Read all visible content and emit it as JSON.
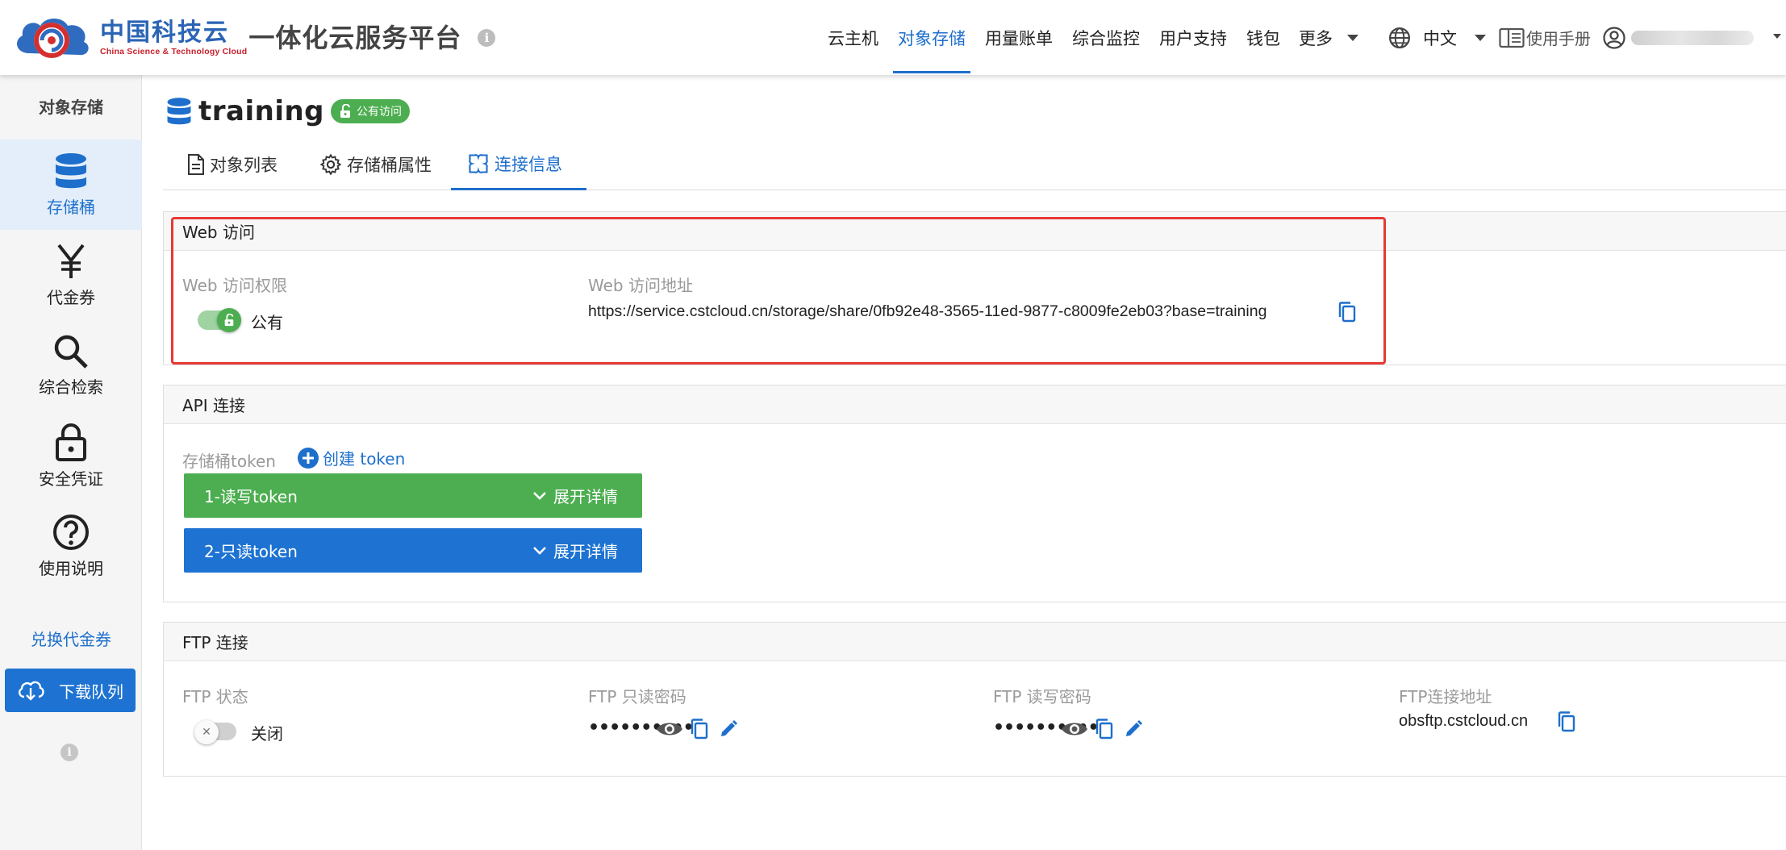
{
  "header": {
    "logo_cn": "中国科技云",
    "logo_en": "China Science & Technology Cloud",
    "platform_title": "一体化云服务平台",
    "nav": [
      {
        "label": "云主机"
      },
      {
        "label": "对象存储"
      },
      {
        "label": "用量账单"
      },
      {
        "label": "综合监控"
      },
      {
        "label": "用户支持"
      },
      {
        "label": "钱包"
      },
      {
        "label": "更多"
      }
    ],
    "language": "中文",
    "manual": "使用手册",
    "accent_color": "#1e6fcc"
  },
  "sidebar": {
    "title": "对象存储",
    "items": [
      {
        "label": "存储桶",
        "icon": "database-icon"
      },
      {
        "label": "代金券",
        "icon": "yen-icon"
      },
      {
        "label": "综合检索",
        "icon": "search-icon"
      },
      {
        "label": "安全凭证",
        "icon": "lock-icon"
      },
      {
        "label": "使用说明",
        "icon": "question-icon"
      }
    ],
    "redeem_link": "兑换代金券",
    "download_queue": "下载队列"
  },
  "bucket": {
    "name": "training",
    "badge": "公有访问"
  },
  "tabs": [
    {
      "label": "对象列表"
    },
    {
      "label": "存储桶属性"
    },
    {
      "label": "连接信息"
    }
  ],
  "web_access": {
    "title": "Web 访问",
    "permission_label": "Web 访问权限",
    "permission_value": "公有",
    "address_label": "Web 访问地址",
    "address_value": "https://service.cstcloud.cn/storage/share/0fb92e48-3565-11ed-9877-c8009fe2eb03?base=training"
  },
  "api": {
    "title": "API 连接",
    "token_label": "存储桶token",
    "create_token": "创建 token",
    "tokens": [
      {
        "label": "1-读写token",
        "expand": "展开详情",
        "color": "#4cae50"
      },
      {
        "label": "2-只读token",
        "expand": "展开详情",
        "color": "#1e73d2"
      }
    ]
  },
  "ftp": {
    "title": "FTP 连接",
    "status_label": "FTP 状态",
    "status_value": "关闭",
    "readonly_pwd_label": "FTP 只读密码",
    "readonly_pwd_mask": "••••••••••",
    "readwrite_pwd_label": "FTP 读写密码",
    "readwrite_pwd_mask": "••••••••••",
    "address_label": "FTP连接地址",
    "address_value": "obsftp.cstcloud.cn"
  }
}
